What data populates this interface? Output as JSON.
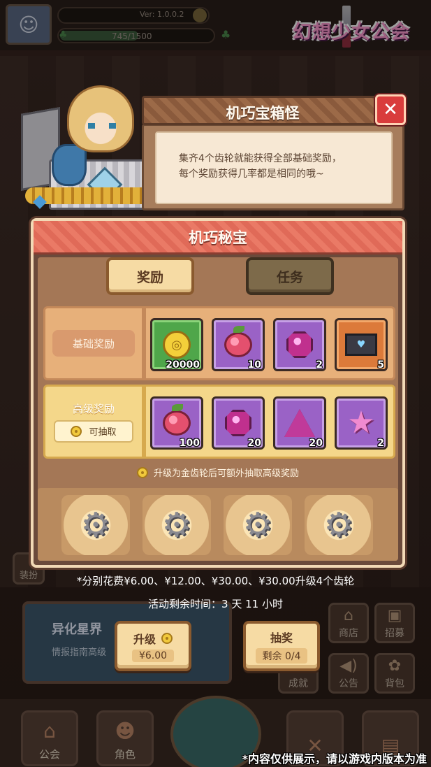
{
  "hud": {
    "version": "Ver: 1.0.0.2",
    "stamina": "745/1500",
    "stamina_fraction": 0.497,
    "logo_text": "幻想少女公会"
  },
  "background": {
    "event_title": "异化星界",
    "event_subtitle": "情报指南高级",
    "equip_label": "装扮",
    "side_buttons": [
      "商店",
      "招募",
      "成就",
      "公告",
      "背包"
    ],
    "nav": [
      "公会",
      "角色"
    ]
  },
  "info_box": {
    "title": "机巧宝箱怪",
    "close_icon": "close-icon",
    "line1": "集齐4个齿轮就能获得全部基础奖励，",
    "line2": "每个奖励获得几率都是相同的哦~"
  },
  "panel": {
    "title": "机巧秘宝",
    "tabs": [
      {
        "label": "奖励",
        "active": true
      },
      {
        "label": "任务",
        "active": false
      }
    ],
    "basic": {
      "label": "基础奖励",
      "items": [
        {
          "icon": "gold-coin-icon",
          "qty": "20000",
          "rarity": "green"
        },
        {
          "icon": "pink-fruit-icon",
          "qty": "10",
          "rarity": "purple"
        },
        {
          "icon": "pink-gem-icon",
          "qty": "2",
          "rarity": "purple"
        },
        {
          "icon": "letter-icon",
          "qty": "5",
          "rarity": "orange"
        }
      ]
    },
    "advanced": {
      "label": "高级奖励",
      "draw_label": "可抽取",
      "items": [
        {
          "icon": "pink-fruit-icon",
          "qty": "100",
          "rarity": "purple"
        },
        {
          "icon": "pink-gem-icon",
          "qty": "20",
          "rarity": "purple"
        },
        {
          "icon": "pink-triangle-icon",
          "qty": "20",
          "rarity": "purple"
        },
        {
          "icon": "pink-star-icon",
          "qty": "2",
          "rarity": "purple"
        }
      ]
    },
    "hint": "升级为金齿轮后可额外抽取高级奖励",
    "gear_slots": 4
  },
  "footer": {
    "cost_note": "*分别花费¥6.00、¥12.00、¥30.00、¥30.00升级4个齿轮",
    "time_left": "活动剩余时间：3 天 11 小时",
    "upgrade_button": {
      "title": "升级",
      "price": "¥6.00"
    },
    "draw_button": {
      "title": "抽奖",
      "remaining": "剩余 0/4"
    },
    "disclaimer": "*内容仅供展示，请以游戏内版本为准"
  },
  "colors": {
    "accent_red": "#e06a58",
    "panel_brown": "#6b4a3b",
    "gold": "#f3cf3a",
    "purple_rarity": "#9a62c6",
    "green_rarity": "#4fa64a",
    "orange_rarity": "#dc7a3a"
  }
}
